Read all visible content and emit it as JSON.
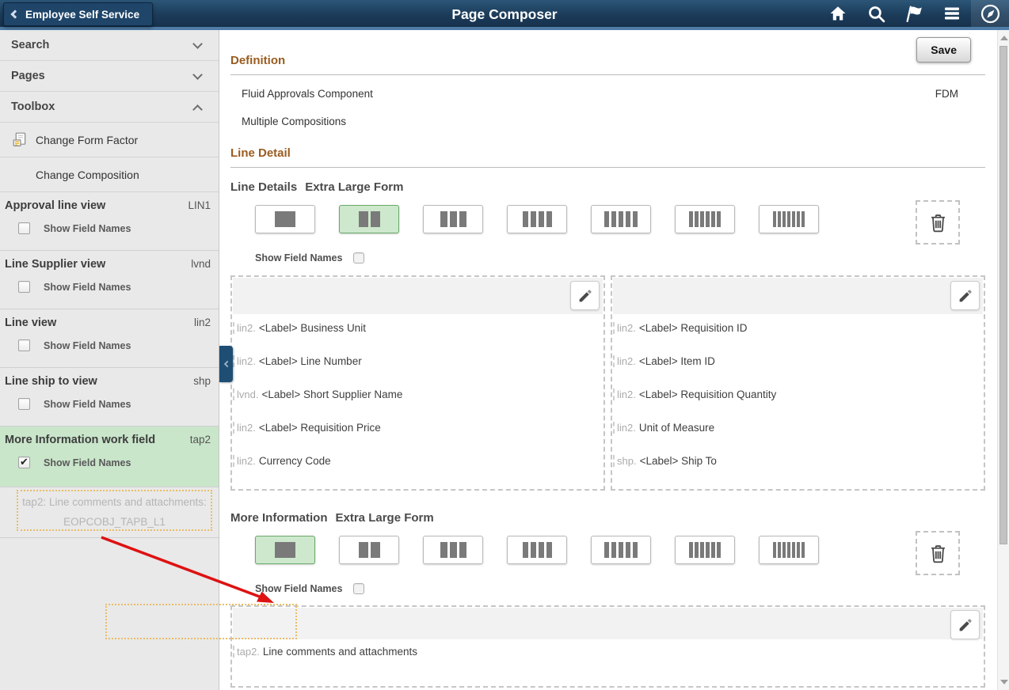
{
  "header": {
    "back_button_label": "Employee Self Service",
    "title": "Page Composer",
    "icons": [
      "home-icon",
      "search-icon",
      "flag-icon",
      "menu-icon",
      "navbar-icon"
    ]
  },
  "sidebar": {
    "sections": [
      {
        "label": "Search",
        "state": "collapsed"
      },
      {
        "label": "Pages",
        "state": "collapsed"
      },
      {
        "label": "Toolbox",
        "state": "expanded"
      }
    ],
    "toolbox": {
      "change_form_factor": "Change Form Factor",
      "change_composition": "Change Composition"
    },
    "views": [
      {
        "name": "Approval line view",
        "code": "LIN1",
        "checkbox_label": "Show Field Names",
        "checked": false,
        "highlighted": false
      },
      {
        "name": "Line Supplier view",
        "code": "lvnd",
        "checkbox_label": "Show Field Names",
        "checked": false,
        "highlighted": false
      },
      {
        "name": "Line view",
        "code": "lin2",
        "checkbox_label": "Show Field Names",
        "checked": false,
        "highlighted": false
      },
      {
        "name": "Line ship to view",
        "code": "shp",
        "checkbox_label": "Show Field Names",
        "checked": false,
        "highlighted": false
      },
      {
        "name": "More Information work field",
        "code": "tap2",
        "checkbox_label": "Show Field Names",
        "checked": true,
        "highlighted": true
      }
    ],
    "drag_ghost": {
      "line1": "tap2: Line comments and attachments:",
      "line2": "EOPCOBJ_TAPB_L1"
    }
  },
  "main": {
    "save_button": "Save",
    "definition": {
      "heading": "Definition",
      "row1_label": "Fluid Approvals Component",
      "row1_value": "FDM",
      "row2_label": "Multiple Compositions"
    },
    "line_detail_heading": "Line Detail",
    "line_details_section": {
      "title": "Line Details",
      "form_factor": "Extra Large Form",
      "layout_options": 7,
      "selected_layout": 2,
      "show_field_names_label": "Show Field Names",
      "show_field_names_checked": false,
      "left_panel_fields": [
        {
          "prefix": "lin2.",
          "label": "<Label> Business Unit"
        },
        {
          "prefix": "lin2.",
          "label": "<Label> Line Number"
        },
        {
          "prefix": "lvnd.",
          "label": "<Label> Short Supplier Name"
        },
        {
          "prefix": "lin2.",
          "label": "<Label> Requisition Price"
        },
        {
          "prefix": "lin2.",
          "label": "Currency Code"
        }
      ],
      "right_panel_fields": [
        {
          "prefix": "lin2.",
          "label": "<Label> Requisition ID"
        },
        {
          "prefix": "lin2.",
          "label": "<Label> Item ID"
        },
        {
          "prefix": "lin2.",
          "label": "<Label> Requisition Quantity"
        },
        {
          "prefix": "lin2.",
          "label": "Unit of Measure"
        },
        {
          "prefix": "shp.",
          "label": "<Label> Ship To"
        }
      ]
    },
    "more_information_section": {
      "title": "More Information",
      "form_factor": "Extra Large Form",
      "layout_options": 7,
      "selected_layout": 1,
      "show_field_names_label": "Show Field Names",
      "show_field_names_checked": false,
      "panel_fields": [
        {
          "prefix": "tap2.",
          "label": "Line comments and attachments"
        }
      ]
    }
  },
  "colors": {
    "header_bg": "#1c3c5a",
    "header_accent": "#4f7da7",
    "heading_brown": "#995c20",
    "selected_green_bg": "#cde8cd",
    "selected_green_border": "#69a869",
    "sidebar_highlight_green": "#c9e5ca",
    "drag_outline_orange": "#e9bd67",
    "arrow_red": "#de1212"
  }
}
